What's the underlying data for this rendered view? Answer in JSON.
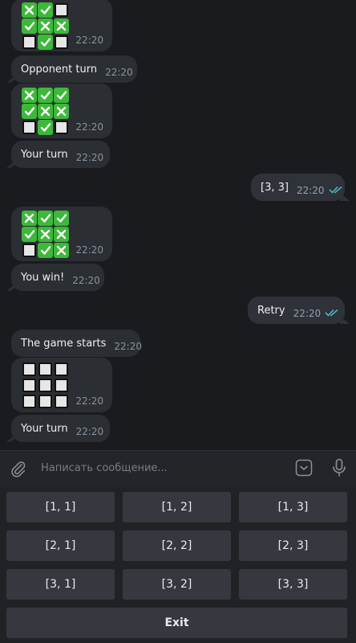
{
  "messages": [
    {
      "type": "grid",
      "cells": [
        "x",
        "check",
        "box",
        "check",
        "x",
        "x",
        "box",
        "check",
        "box"
      ],
      "time": "22:20"
    },
    {
      "type": "text",
      "text": "Opponent turn",
      "time": "22:20"
    },
    {
      "type": "grid",
      "cells": [
        "x",
        "check",
        "check",
        "check",
        "x",
        "x",
        "box",
        "check",
        "box"
      ],
      "time": "22:20"
    },
    {
      "type": "text",
      "text": "Your turn",
      "time": "22:20"
    },
    {
      "type": "text",
      "text": "[3, 3]",
      "time": "22:20",
      "outgoing": true,
      "read": true
    },
    {
      "type": "grid",
      "cells": [
        "x",
        "check",
        "check",
        "check",
        "x",
        "x",
        "box",
        "check",
        "x"
      ],
      "time": "22:20"
    },
    {
      "type": "text",
      "text": "You win!",
      "time": "22:20"
    },
    {
      "type": "text",
      "text": "Retry",
      "time": "22:20",
      "outgoing": true,
      "read": true
    },
    {
      "type": "text",
      "text": "The game starts",
      "time": "22:20"
    },
    {
      "type": "grid",
      "cells": [
        "box",
        "box",
        "box",
        "box",
        "box",
        "box",
        "box",
        "box",
        "box"
      ],
      "time": "22:20"
    },
    {
      "type": "text",
      "text": "Your turn",
      "time": "22:20"
    }
  ],
  "input": {
    "placeholder": "Написать сообщение..."
  },
  "keyboard": {
    "rows": [
      [
        "[1, 1]",
        "[1, 2]",
        "[1, 3]"
      ],
      [
        "[2, 1]",
        "[2, 2]",
        "[2, 3]"
      ],
      [
        "[3, 1]",
        "[3, 2]",
        "[3, 3]"
      ],
      [
        "Exit"
      ]
    ]
  },
  "colors": {
    "background": "#1a1b1f",
    "bubble": "#2b2e33",
    "check_green": "#3db83a",
    "read_ticks": "#4fb3c7"
  }
}
